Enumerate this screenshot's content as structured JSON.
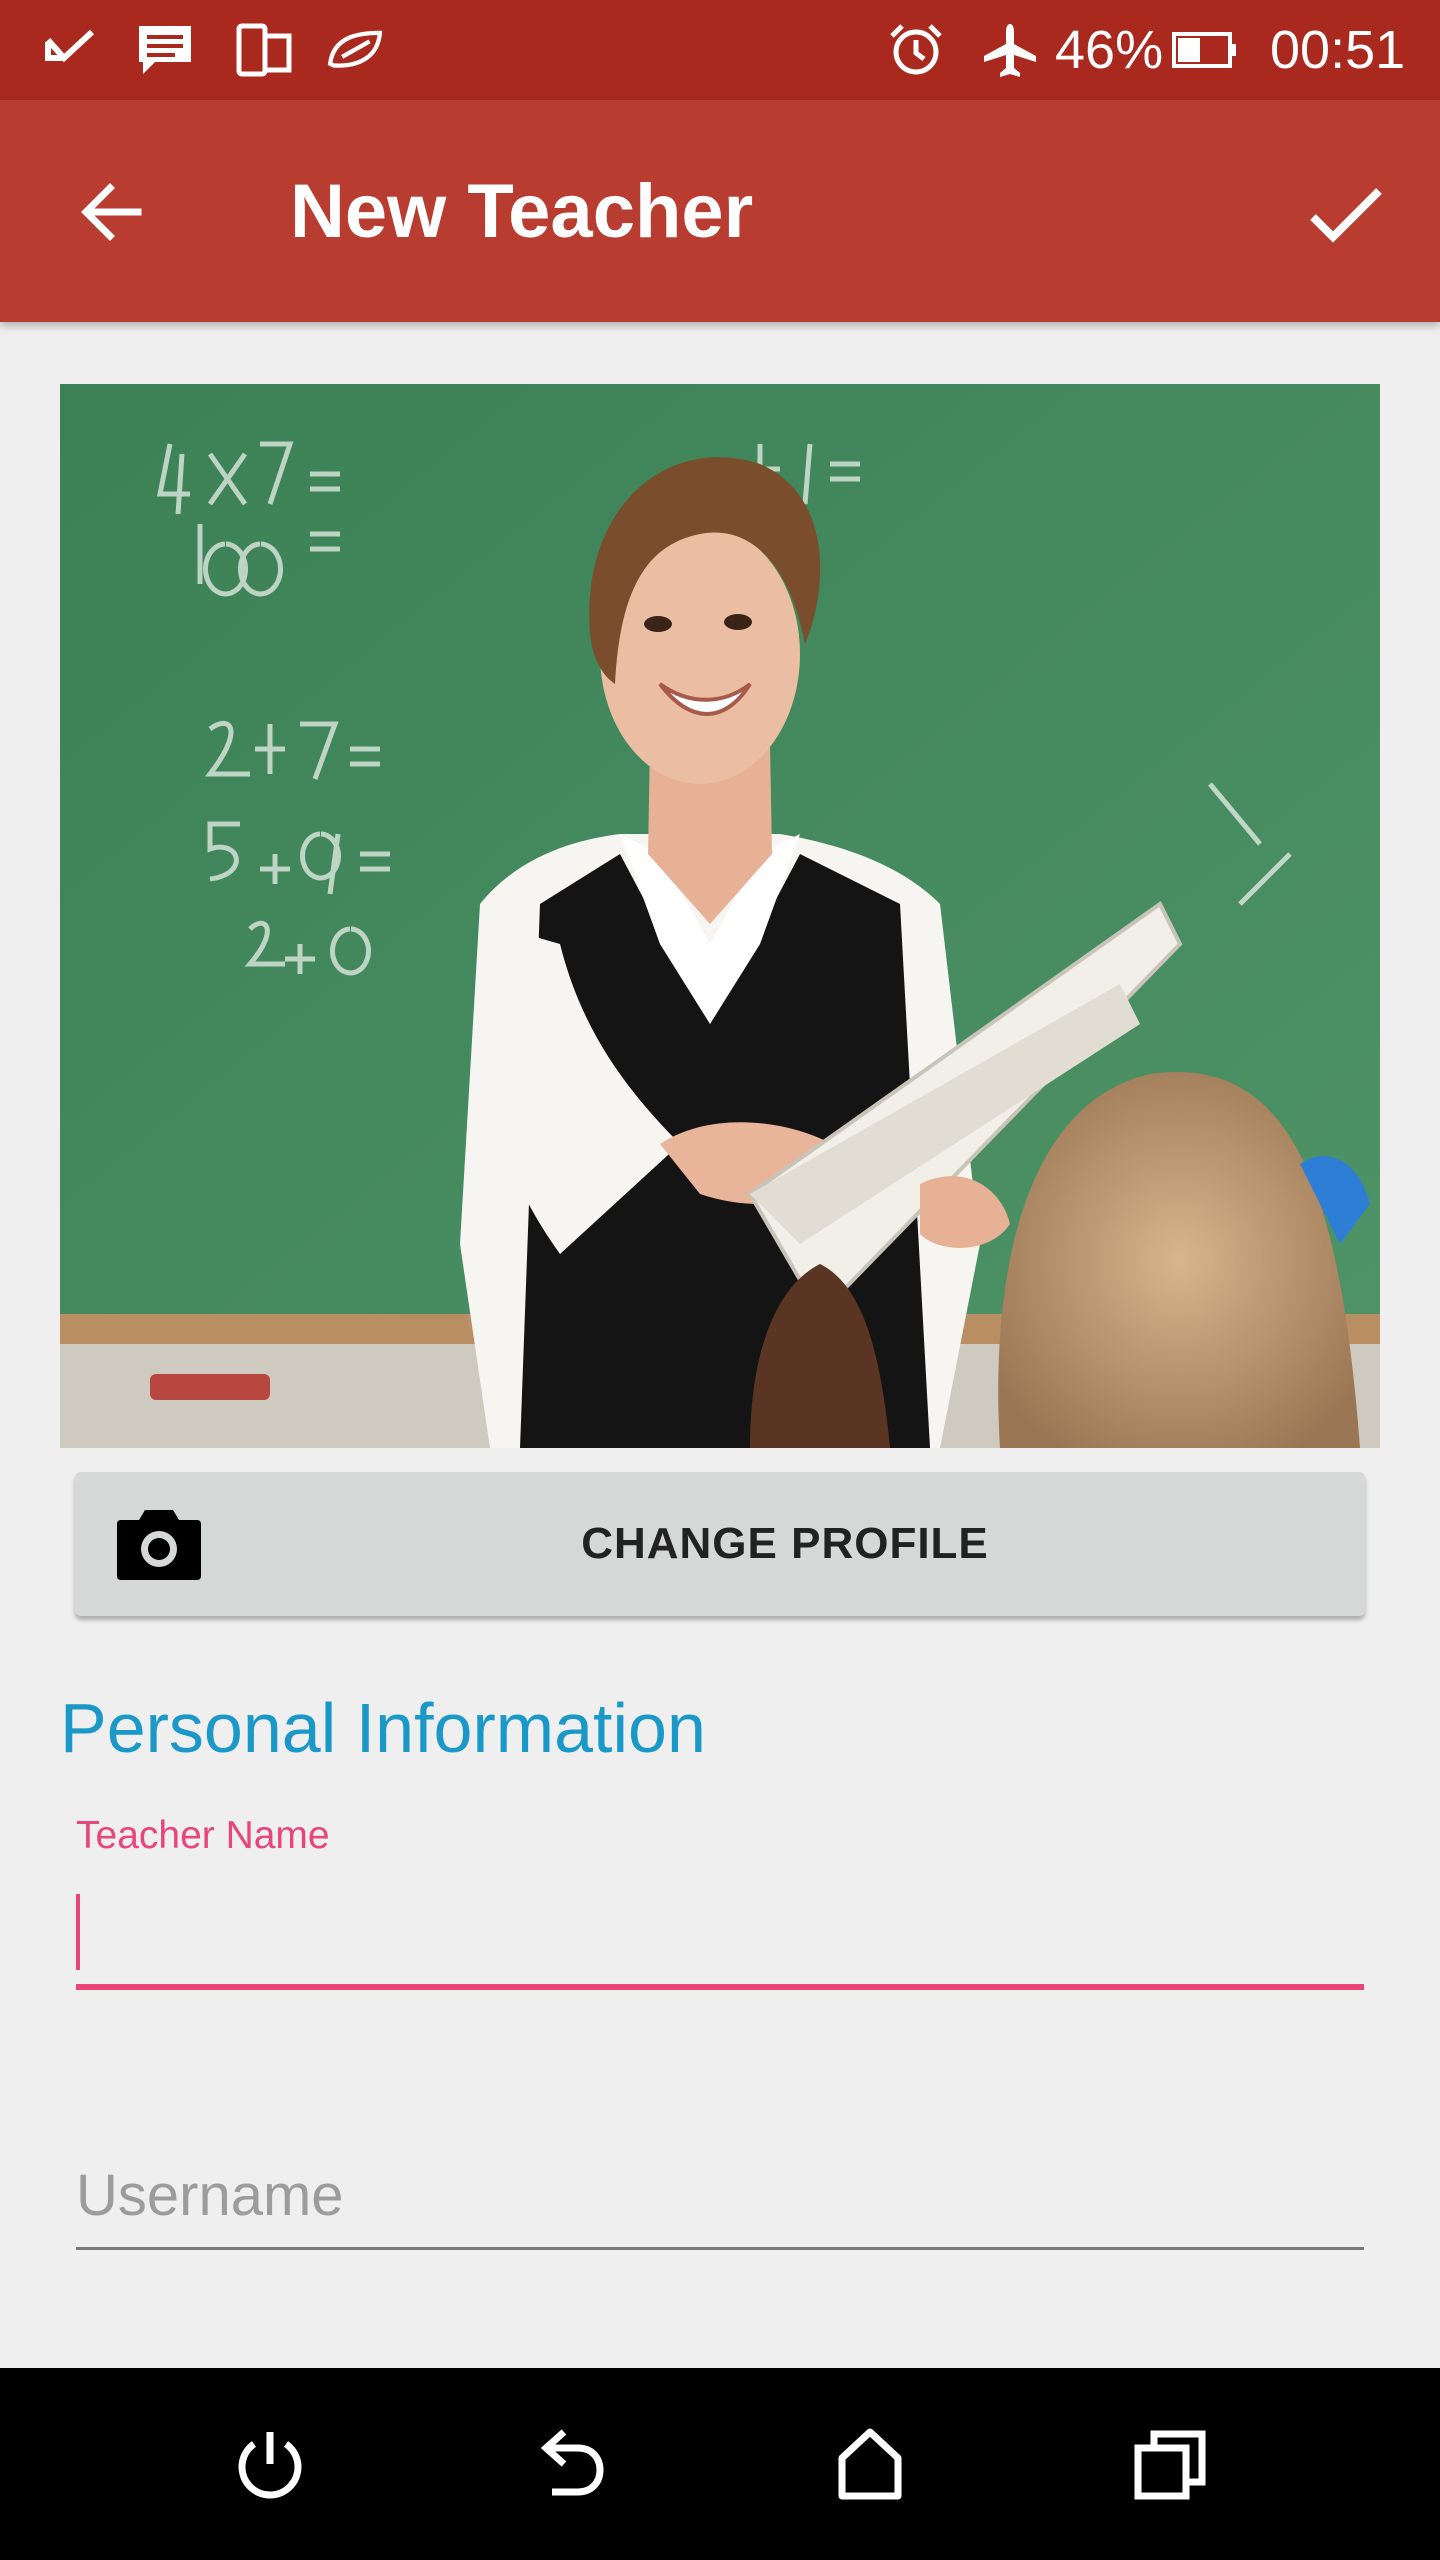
{
  "status_bar": {
    "battery_percent": "46%",
    "battery_level": 0.46,
    "time": "00:51",
    "icons": [
      "check-notification-icon",
      "message-icon",
      "dual-screen-icon",
      "leaf-icon",
      "alarm-icon",
      "airplane-mode-icon",
      "battery-icon"
    ]
  },
  "app_bar": {
    "title": "New Teacher",
    "back_icon": "arrow-left-icon",
    "done_icon": "check-icon"
  },
  "profile": {
    "photo_description_icon": "teacher-photo",
    "change_button_label": "CHANGE PROFILE",
    "change_button_icon": "camera-icon"
  },
  "form": {
    "section_title": "Personal Information",
    "teacher_name": {
      "label": "Teacher Name",
      "value": ""
    },
    "username": {
      "placeholder": "Username",
      "value": ""
    }
  },
  "colors": {
    "status_bar": "#a9291e",
    "app_bar": "#b93c30",
    "accent_pink": "#e8457b",
    "section_blue": "#1a98c7"
  },
  "nav_bar": {
    "icons": [
      "power-icon",
      "back-icon",
      "home-icon",
      "recents-icon"
    ]
  }
}
